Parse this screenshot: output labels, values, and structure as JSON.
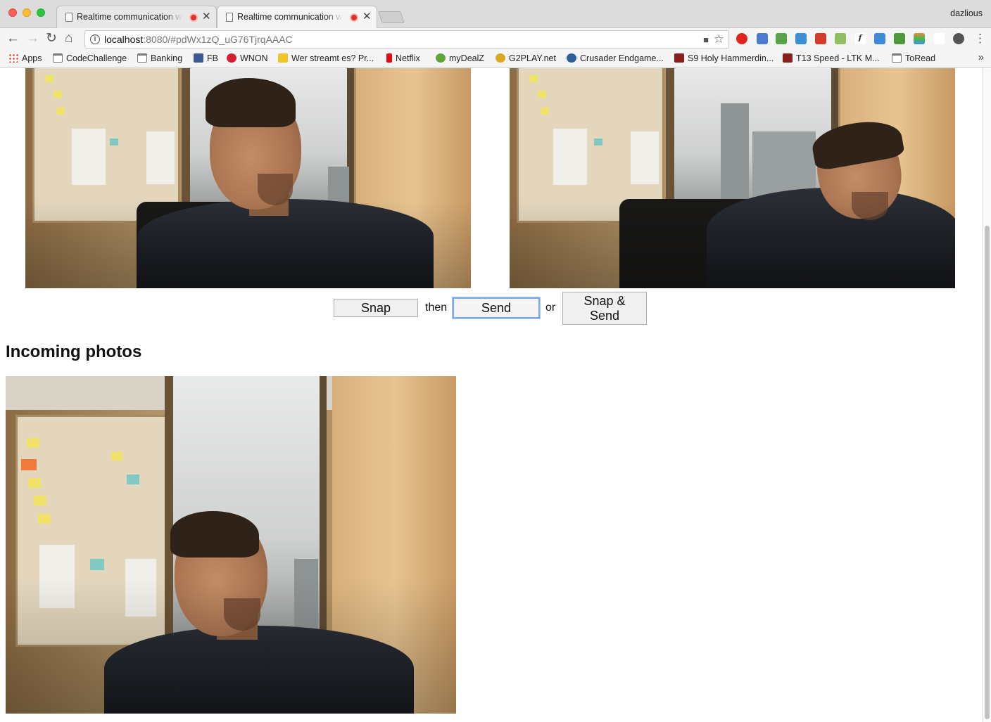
{
  "browser": {
    "tabs": [
      {
        "title": "Realtime communication with WebRTC",
        "active": false
      },
      {
        "title": "Realtime communication with WebRTC",
        "active": true
      }
    ],
    "profile_name": "dazlious",
    "url_host": "localhost",
    "url_rest": ":8080/#pdWx1zQ_uG76TjrqAAAC",
    "bookmarks": [
      {
        "label": "Apps",
        "icon": "apps-grid-icon"
      },
      {
        "label": "CodeChallenge",
        "icon": "folder-icon"
      },
      {
        "label": "Banking",
        "icon": "folder-icon"
      },
      {
        "label": "FB",
        "icon": "facebook-icon"
      },
      {
        "label": "WNON",
        "icon": "wnon-icon"
      },
      {
        "label": "Wer streamt es? Pr...",
        "icon": "wer-streamt-icon"
      },
      {
        "label": "Netflix",
        "icon": "netflix-icon"
      },
      {
        "label": "myDealZ",
        "icon": "mydealz-icon"
      },
      {
        "label": "G2PLAY.net",
        "icon": "g2play-icon"
      },
      {
        "label": "Crusader Endgame...",
        "icon": "crusader-icon"
      },
      {
        "label": "S9 Holy Hammerdin...",
        "icon": "hammerdin-icon"
      },
      {
        "label": "T13 Speed - LTK M...",
        "icon": "ltk-icon"
      },
      {
        "label": "ToRead",
        "icon": "folder-icon"
      }
    ],
    "icons": {
      "back": "←",
      "forward": "→",
      "reload": "↻",
      "home": "⌂",
      "star": "☆",
      "camera": "■",
      "close": "✕",
      "more": "⋮",
      "overflow": "»"
    }
  },
  "page": {
    "snap_label": "Snap",
    "then_text": "then",
    "send_label": "Send",
    "or_text": "or",
    "snap_send_label_line1": "Snap &",
    "snap_send_label_line2": "Send",
    "incoming_heading": "Incoming photos"
  }
}
